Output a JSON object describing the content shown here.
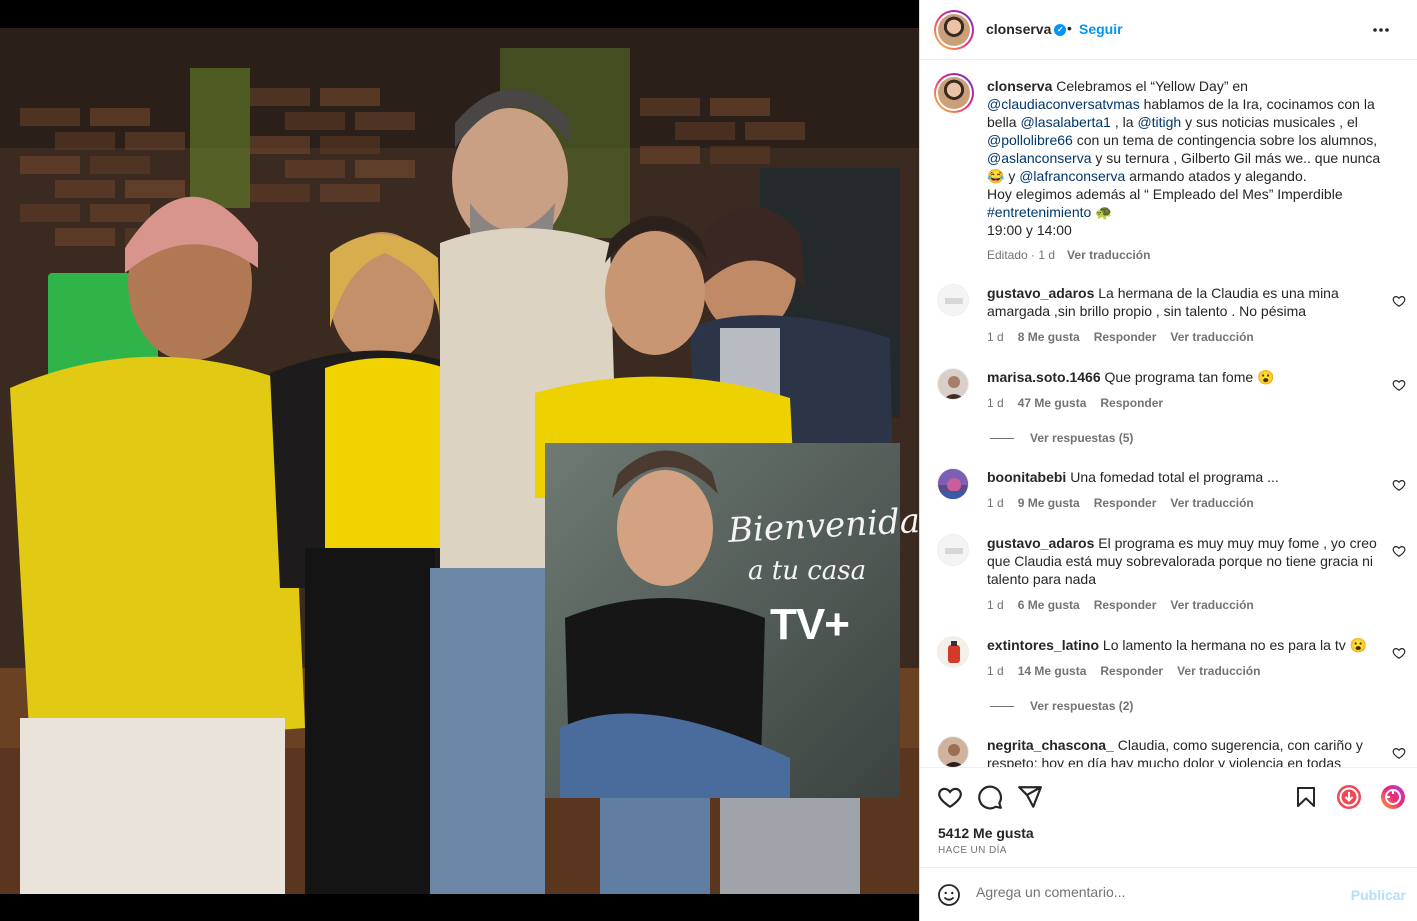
{
  "post": {
    "username": "clonserva",
    "follow_label": "Seguir",
    "separator": "•",
    "more_label": "•••",
    "verified_glyph": "✓",
    "caption": {
      "username": "clonserva",
      "lines": [
        [
          "Celebramos el “Yellow Day” en"
        ],
        [
          "@claudiaconversatvmas",
          " hablamos de la Ira, cocinamos con la"
        ],
        [
          "bella ",
          "@lasalaberta1",
          " , la ",
          "@titigh",
          " y sus noticias musicales , el"
        ],
        [
          "@pollolibre66",
          " con un tema de contingencia sobre los alumnos,"
        ],
        [
          "@aslanconserva",
          " y su ternura , Gilberto Gil más we.. que nunca"
        ],
        [
          "😂 y ",
          "@lafranconserva",
          " armando atados y alegando."
        ],
        [
          "Hoy elegimos además al “ Empleado del Mes” Imperdible"
        ],
        [
          "#entretenimiento",
          " 🐢"
        ],
        [
          "19:00 y 14:00"
        ]
      ],
      "edited": "Editado · 1 d",
      "translate": "Ver traducción"
    },
    "comments": [
      {
        "user": "gustavo_adaros",
        "text": "La hermana de la Claudia es una mina amargada ,sin brillo propio , sin talento . No pésima",
        "time": "1 d",
        "likes": "8 Me gusta",
        "reply": "Responder",
        "translate": "Ver traducción"
      },
      {
        "user": "marisa.soto.1466",
        "text": "Que programa tan fome 😮",
        "time": "1 d",
        "likes": "47 Me gusta",
        "reply": "Responder",
        "view_replies": "Ver respuestas (5)"
      },
      {
        "user": "boonitabebi",
        "text": "Una fomedad total el programa ...",
        "time": "1 d",
        "likes": "9 Me gusta",
        "reply": "Responder",
        "translate": "Ver traducción"
      },
      {
        "user": "gustavo_adaros",
        "text": "El programa es muy muy muy fome , yo creo que Claudia está muy sobrevalorada porque no tiene gracia ni talento para nada",
        "time": "1 d",
        "likes": "6 Me gusta",
        "reply": "Responder",
        "translate": "Ver traducción"
      },
      {
        "user": "extintores_latino",
        "text": "Lo lamento la hermana no es para la tv 😮",
        "time": "1 d",
        "likes": "14 Me gusta",
        "reply": "Responder",
        "translate": "Ver traducción",
        "view_replies": "Ver respuestas (2)"
      },
      {
        "user": "negrita_chascona_",
        "text": "Claudia, como sugerencia, con cariño y respeto: hoy en día hay mucho dolor y violencia en todas"
      }
    ],
    "likes_count": "5412 Me gusta",
    "time_ago": "HACE UN DÍA",
    "comment_placeholder": "Agrega un comentario...",
    "publish_label": "Publicar",
    "emoji_glyph": "☺"
  },
  "photo_sign": {
    "line1": "Bienvenida",
    "line2": "a tu casa",
    "logo": "TV+"
  },
  "colors": {
    "accent_blue": "#0095f6",
    "mention": "#00376b",
    "muted": "#737373",
    "shirt_yellow": "#f2d500",
    "like_red": "#ed4956"
  },
  "icons": [
    "heart-icon",
    "comment-icon",
    "share-icon",
    "bookmark-icon",
    "download-icon",
    "reels-icon",
    "emoji-icon",
    "verified-icon",
    "more-icon"
  ]
}
